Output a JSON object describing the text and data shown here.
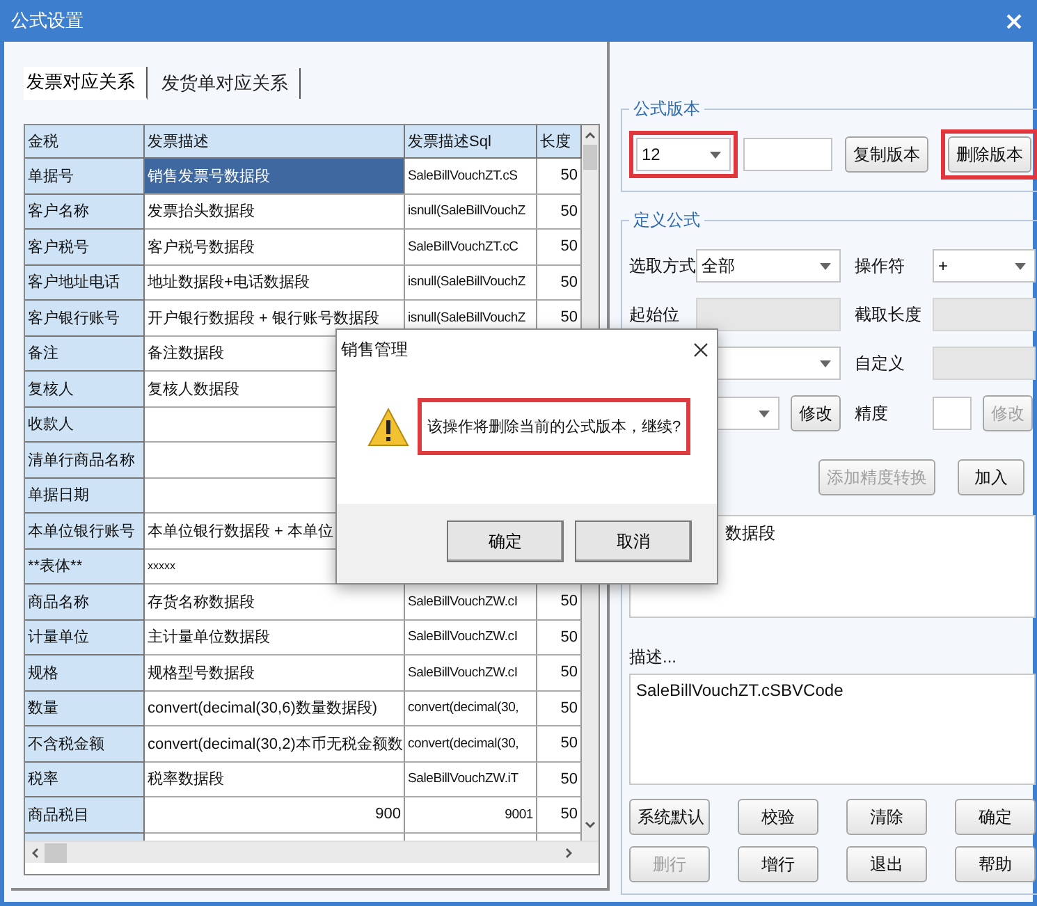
{
  "window": {
    "title": "公式设置"
  },
  "tabs": [
    {
      "label": "发票对应关系",
      "selected": true
    },
    {
      "label": "发货单对应关系",
      "selected": false
    }
  ],
  "table": {
    "columns": [
      "金税",
      "发票描述",
      "发票描述Sql",
      "长度"
    ],
    "rows": [
      {
        "label": "单据号",
        "desc": "销售发票号数据段",
        "sql": "SaleBillVouchZT.cS",
        "length": "50",
        "selected": true
      },
      {
        "label": "客户名称",
        "desc": "发票抬头数据段",
        "sql": "isnull(SaleBillVouchZ",
        "length": "50",
        "selected": false
      },
      {
        "label": "客户税号",
        "desc": "客户税号数据段",
        "sql": "SaleBillVouchZT.cC",
        "length": "50",
        "selected": false
      },
      {
        "label": "客户地址电话",
        "desc": "地址数据段+电话数据段",
        "sql": "isnull(SaleBillVouchZ",
        "length": "50",
        "selected": false
      },
      {
        "label": "客户银行账号",
        "desc": "开户银行数据段 + 银行账号数据段",
        "sql": "isnull(SaleBillVouchZ",
        "length": "50",
        "selected": false
      },
      {
        "label": "备注",
        "desc": "备注数据段",
        "selected": false
      },
      {
        "label": "复核人",
        "desc": "复核人数据段",
        "selected": false
      },
      {
        "label": "收款人",
        "selected": false
      },
      {
        "label": "清单行商品名称",
        "selected": false
      },
      {
        "label": "单据日期",
        "selected": false
      },
      {
        "label": "本单位银行账号",
        "desc": "本单位银行数据段 + 本单位",
        "selected": false
      },
      {
        "label": "**表体**",
        "desc": "xxxxx",
        "selected": false
      },
      {
        "label": "商品名称",
        "desc": "存货名称数据段",
        "sql": "SaleBillVouchZW.cI",
        "length": "50",
        "selected": false
      },
      {
        "label": "计量单位",
        "desc": "主计量单位数据段",
        "sql": "SaleBillVouchZW.cI",
        "length": "50",
        "selected": false
      },
      {
        "label": "规格",
        "desc": "规格型号数据段",
        "sql": "SaleBillVouchZW.cI",
        "length": "50",
        "selected": false
      },
      {
        "label": "数量",
        "desc": "convert(decimal(30,6)数量数据段)",
        "sql": "convert(decimal(30,",
        "length": "50",
        "selected": false
      },
      {
        "label": "不含税金额",
        "desc": "convert(decimal(30,2)本币无税金额数",
        "sql": "convert(decimal(30,",
        "length": "50",
        "selected": false
      },
      {
        "label": "税率",
        "desc": "税率数据段",
        "sql": "SaleBillVouchZW.iT",
        "length": "50",
        "selected": false
      },
      {
        "label": "商品税目",
        "kind": "numeric",
        "desc": "900",
        "sql": "9001",
        "length": "50",
        "selected": false
      }
    ]
  },
  "version_group": {
    "title": "公式版本",
    "version": "12",
    "version_highlighted": true,
    "buttons": [
      {
        "label": "复制版本",
        "highlighted": false
      },
      {
        "label": "删除版本",
        "highlighted": true
      }
    ]
  },
  "define_group": {
    "title": "定义公式",
    "rows": [
      {
        "left": {
          "label": "选取方式",
          "kind": "combo",
          "value": "全部"
        },
        "right": {
          "label": "操作符",
          "kind": "combo",
          "value": "+"
        }
      },
      {
        "left": {
          "label": "起始位",
          "kind": "input",
          "disabled": true
        },
        "right": {
          "label": "截取长度",
          "kind": "input",
          "disabled": true
        }
      },
      {
        "left": {
          "kind": "combo"
        },
        "right": {
          "label": "自定义",
          "kind": "input",
          "disabled": true
        }
      },
      {
        "left": {
          "kind": "combo",
          "button": {
            "label": "修改",
            "disabled": false
          }
        },
        "right": {
          "label": "精度",
          "kind": "input",
          "disabled": false,
          "button": {
            "label": "修改",
            "disabled": true
          }
        }
      }
    ],
    "actions": [
      {
        "label": "添加精度转换",
        "disabled": true
      },
      {
        "label": "加入",
        "disabled": false
      }
    ],
    "formula_text": "数据段",
    "desc_label": "描述...",
    "desc_text": "SaleBillVouchZT.cSBVCode",
    "buttons": [
      {
        "label": "系统默认",
        "disabled": false
      },
      {
        "label": "校验",
        "disabled": false
      },
      {
        "label": "清除",
        "disabled": false
      },
      {
        "label": "确定",
        "disabled": false
      },
      {
        "label": "删行",
        "disabled": true
      },
      {
        "label": "增行",
        "disabled": false
      },
      {
        "label": "退出",
        "disabled": false
      },
      {
        "label": "帮助",
        "disabled": false
      }
    ]
  },
  "dialog": {
    "title": "销售管理",
    "message": "该操作将删除当前的公式版本，继续?",
    "message_highlighted": true,
    "buttons": [
      {
        "label": "确定"
      },
      {
        "label": "取消"
      }
    ]
  }
}
